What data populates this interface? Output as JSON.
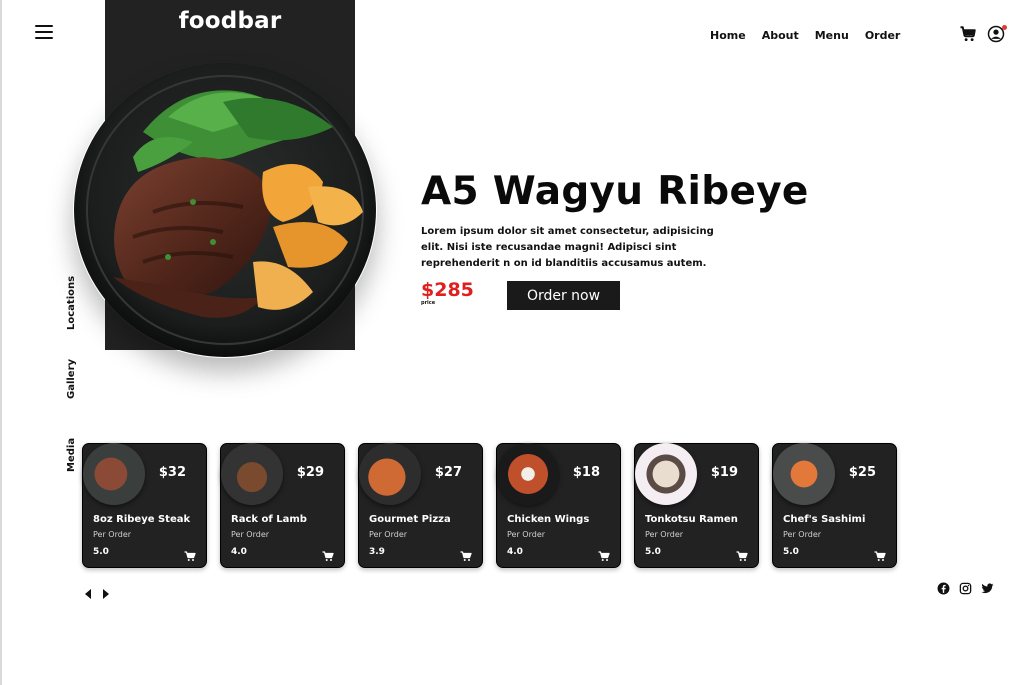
{
  "brand": {
    "name": "foodbar"
  },
  "nav": {
    "items": [
      "Home",
      "About",
      "Menu",
      "Order"
    ]
  },
  "side_nav": {
    "items": [
      "Locations",
      "Gallery",
      "Media"
    ]
  },
  "hero": {
    "title": "A5 Wagyu Ribeye",
    "description": "Lorem ipsum dolor sit amet consectetur, adipisicing elit. Nisi iste recusandae magni! Adipisci sint reprehenderit n on id blanditiis accusamus autem.",
    "price": "$285",
    "price_label": "price",
    "order_label": "Order now"
  },
  "cards": [
    {
      "name": "8oz Ribeye Steak",
      "price": "$32",
      "sub": "Per Order",
      "rating": "5.0",
      "thumb_color": "#6b3b2a"
    },
    {
      "name": "Rack of Lamb",
      "price": "$29",
      "sub": "Per Order",
      "rating": "4.0",
      "thumb_color": "#7a4a2e"
    },
    {
      "name": "Gourmet Pizza",
      "price": "$27",
      "sub": "Per Order",
      "rating": "3.9",
      "thumb_color": "#c8602e"
    },
    {
      "name": "Chicken Wings",
      "price": "$18",
      "sub": "Per Order",
      "rating": "4.0",
      "thumb_color": "#b9482a"
    },
    {
      "name": "Tonkotsu Ramen",
      "price": "$19",
      "sub": "Per Order",
      "rating": "5.0",
      "thumb_color": "#d8cfc4"
    },
    {
      "name": "Chef's Sashimi",
      "price": "$25",
      "sub": "Per Order",
      "rating": "5.0",
      "thumb_color": "#d66a2e"
    }
  ],
  "icons": {
    "menu": "hamburger-icon",
    "cart": "cart-icon",
    "user": "user-icon",
    "prev": "arrow-left-icon",
    "next": "arrow-right-icon",
    "social": [
      "facebook-icon",
      "instagram-icon",
      "twitter-icon"
    ]
  },
  "colors": {
    "accent_price": "#e01f1f",
    "dark_panel": "#222222",
    "notification": "#e53935"
  }
}
